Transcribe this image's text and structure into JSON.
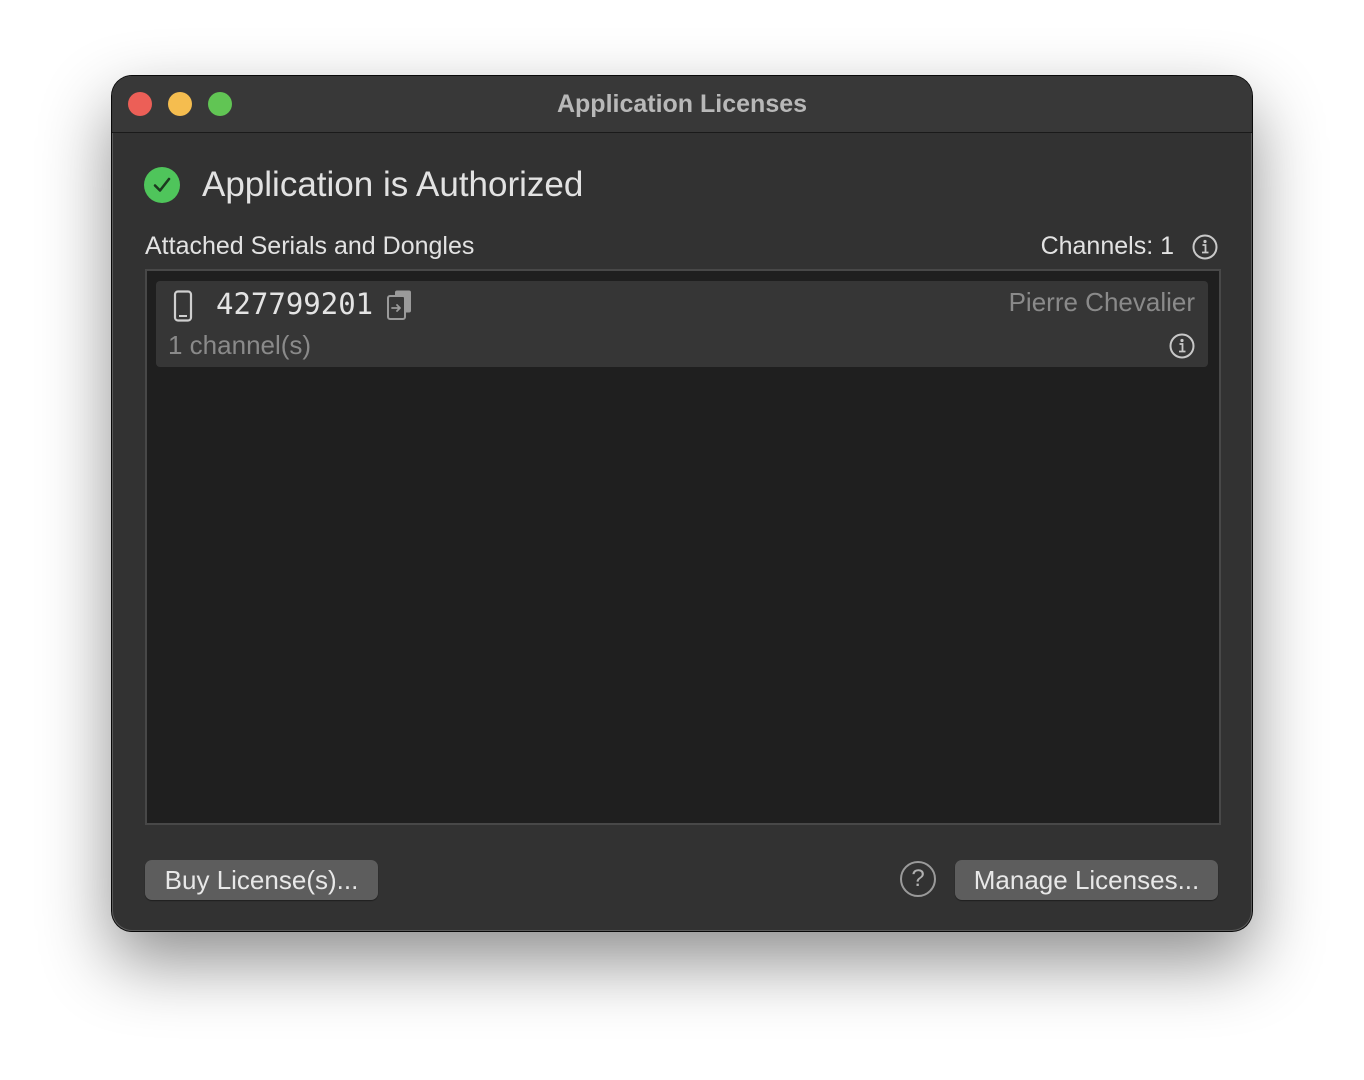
{
  "window": {
    "title": "Application Licenses",
    "traffic_lights": {
      "close_color": "#ec5f57",
      "minimize_color": "#f5bd4f",
      "maximize_color": "#61c554"
    }
  },
  "status": {
    "icon": "check-circle-icon",
    "icon_color": "#4fc55b",
    "text": "Application is Authorized"
  },
  "section": {
    "label": "Attached Serials and Dongles",
    "channels_label": "Channels: 1",
    "info_icon": "info-icon"
  },
  "licenses": [
    {
      "device_icon": "phone-device-icon",
      "serial": "427799201",
      "copy_icon": "copy-icon",
      "owner": "Pierre Chevalier",
      "channels": "1 channel(s)",
      "info_icon": "info-icon"
    }
  ],
  "footer": {
    "buy_label": "Buy License(s)...",
    "help_label": "?",
    "manage_label": "Manage Licenses..."
  }
}
